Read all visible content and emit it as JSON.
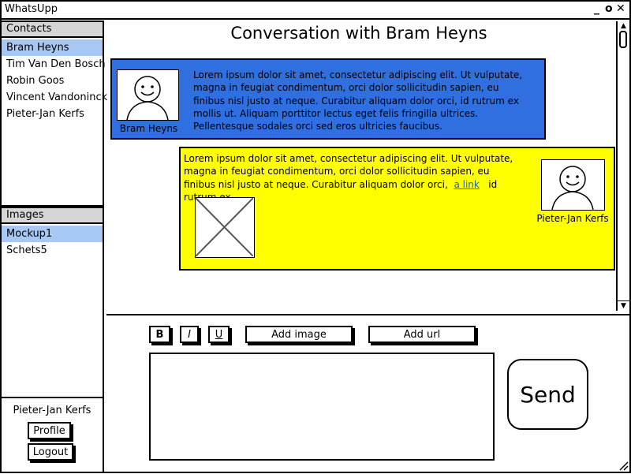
{
  "app": {
    "title": "WhatsUpp"
  },
  "window_controls": {
    "minimize": "_",
    "maximize": "o",
    "close": "✕"
  },
  "contacts": {
    "header": "Contacts",
    "items": [
      "Bram Heyns",
      "Tim Van Den Bosch",
      "Robin Goos",
      "Vincent Vandoninck",
      "Pieter-Jan Kerfs"
    ],
    "selected_index": 0
  },
  "images": {
    "header": "Images",
    "items": [
      "Mockup1",
      "Schets5"
    ],
    "selected_index": 0
  },
  "user": {
    "name": "Pieter-Jan Kerfs",
    "profile_label": "Profile",
    "logout_label": "Logout"
  },
  "conversation": {
    "title": "Conversation with Bram Heyns",
    "messages": [
      {
        "sender": "Bram Heyns",
        "text": "Lorem ipsum dolor sit amet, consectetur adipiscing elit. Ut vulputate, magna in feugiat condimentum, orci dolor sollicitudin sapien, eu finibus nisl justo at neque. Curabitur aliquam dolor orci, id rutrum ex mollis ut. Aliquam porttitor lectus eget felis fringilla ultrices. Pellentesque sodales orci sed eros ultricies faucibus.",
        "color": "#2f6fe0"
      },
      {
        "sender": "Pieter-Jan Kerfs",
        "text_before_link": "Lorem ipsum dolor sit amet, consectetur adipiscing elit. Ut vulputate, magna in feugiat condimentum, orci dolor sollicitudin sapien, eu finibus nisl justo at neque. Curabitur aliquam dolor orci,",
        "link_text": "a link",
        "text_after_link": "id rutrum ex.",
        "color": "#ffff00"
      }
    ]
  },
  "toolbar": {
    "bold": "B",
    "italic": "I",
    "underline": "U",
    "add_image": "Add image",
    "add_url": "Add url"
  },
  "composer": {
    "value": "",
    "send_label": "Send"
  },
  "icons": {
    "scroll_up": "▲",
    "scroll_down": "▼",
    "resize": "⁄⁄"
  }
}
